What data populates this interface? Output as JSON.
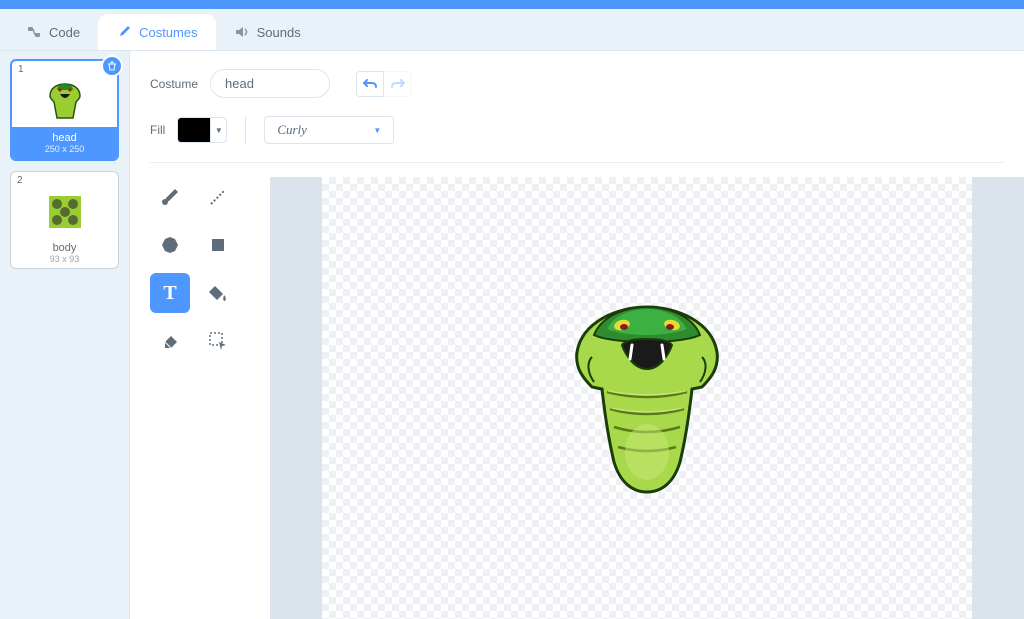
{
  "tabs": {
    "code": "Code",
    "costumes": "Costumes",
    "sounds": "Sounds"
  },
  "costumes": [
    {
      "num": "1",
      "name": "head",
      "dims": "250 x 250",
      "selected": true
    },
    {
      "num": "2",
      "name": "body",
      "dims": "93 x 93",
      "selected": false
    }
  ],
  "editor": {
    "costume_label": "Costume",
    "costume_name": "head",
    "fill_label": "Fill",
    "font_name": "Curly"
  },
  "tools": {
    "brush": "brush",
    "line": "line",
    "circle": "circle",
    "square": "square",
    "text": "T",
    "fillbucket": "fill",
    "eraser": "eraser",
    "select": "select"
  }
}
